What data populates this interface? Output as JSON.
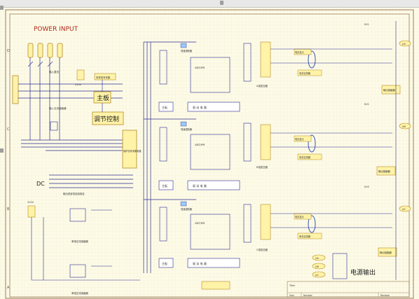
{
  "title": "POWER INPUT",
  "border_rows": [
    "D",
    "C",
    "B",
    "A"
  ],
  "labels": {
    "main_board": "主板",
    "regulation_control": "调节控制",
    "power_output": "电源输出",
    "dc": "DC",
    "title_block_title": "Title",
    "title_block_size": "Size",
    "title_block_number": "Number",
    "title_block_revision": "Revision",
    "v220_top": "220V",
    "v220_left": "220V",
    "rectifier_filter": "输入整流",
    "input_contactor": "输入交流接触器",
    "sample_boards": "采样信号采集",
    "protect_sample": "保护信号采集电路",
    "filter_caps": "输出滤波电容组电容",
    "ac_contactor_1": "单相交流接触器",
    "ac_contactor_2": "单相交流接触器",
    "igbt_1": "IGBT/IPM",
    "igbt_2": "IGBT/IPM",
    "igbt_3": "IGBT/IPM",
    "drive_1": "驱 动 电 路",
    "drive_2": "驱 动 电 路",
    "drive_3": "驱 动 电 路",
    "board_1": "主板",
    "board_2": "主板",
    "board_3": "主板",
    "fuse_1": "快速熔断器",
    "fuse_2": "快速熔断器",
    "fuse_3": "快速熔断器",
    "transformer_a": "A相变压器",
    "transformer_b": "B相变压器",
    "transformer_c": "C相变压器",
    "current_transformer_1": "电流互感器",
    "current_transformer_2": "电流互感器",
    "current_transformer_3": "电流互感器",
    "voltage_display_1": "电压显示",
    "voltage_display_2": "电压显示",
    "voltage_display_3": "电压显示",
    "output_contactor": "输出接触器",
    "kv_out_1": "KV1",
    "kv_out_2": "KV2",
    "kv_out_3": "KV3"
  },
  "terminals_right": [
    "UA",
    "UB",
    "UC"
  ],
  "terminals_output": [
    "UA",
    "UB",
    "UC"
  ],
  "title_block": {
    "title": "",
    "size": "",
    "number": "",
    "revision": ""
  }
}
